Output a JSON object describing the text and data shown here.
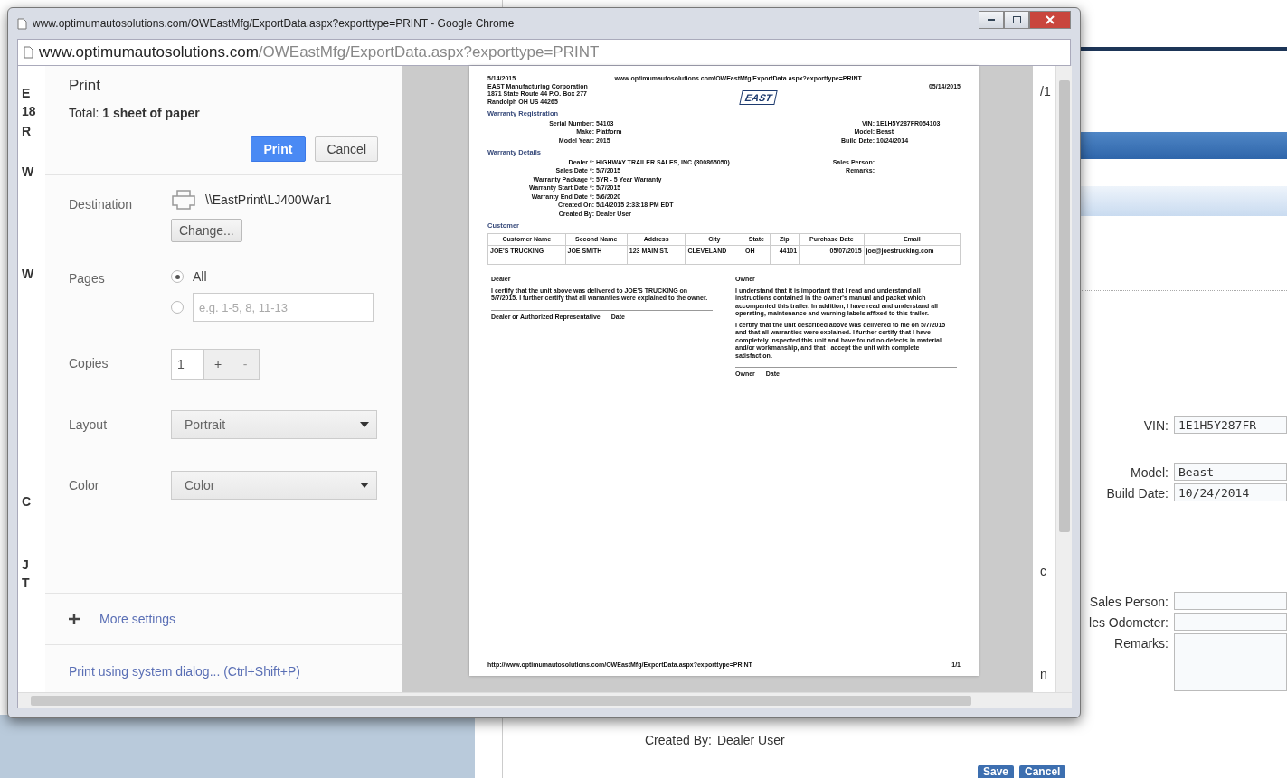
{
  "background_page": {
    "left_cut_texts": [
      "E",
      "18",
      "R",
      "W",
      "W",
      "C",
      "J",
      "T"
    ],
    "right_cut_texts": [
      "/1",
      "c",
      "n"
    ],
    "form_fields": [
      {
        "label": "VIN:",
        "kind": "input",
        "value": "1E1H5Y287FR"
      },
      {
        "label": "Model:",
        "kind": "input",
        "value": "Beast"
      },
      {
        "label": "Build Date:",
        "kind": "input",
        "value": "10/24/2014"
      },
      {
        "label": "Sales Person:",
        "kind": "input"
      },
      {
        "label": "les Odometer:",
        "kind": "input"
      },
      {
        "label": "Remarks:",
        "kind": "textarea"
      }
    ],
    "created_by": {
      "label": "Created By:",
      "value": "Dealer User"
    },
    "buttons": [
      "Save",
      "Cancel"
    ]
  },
  "browser_window": {
    "title": "www.optimumautosolutions.com/OWEastMfg/ExportData.aspx?exporttype=PRINT - Google Chrome",
    "address": {
      "host": "www.optimumautosolutions.com",
      "path": "/OWEastMfg/ExportData.aspx?exporttype=PRINT"
    }
  },
  "print_panel": {
    "title": "Print",
    "total": "Total: **1 sheet of paper**",
    "buttons": [
      {
        "label": "Print",
        "kind": "primary"
      },
      {
        "label": "Cancel",
        "kind": "secondary"
      }
    ],
    "destination": {
      "label": "Destination",
      "printer": "\\\\EastPrint\\LJ400War1",
      "change": "Change..."
    },
    "pages": {
      "label": "Pages",
      "options": [
        {
          "label": "All",
          "selected": true
        },
        {
          "placeholder": "e.g. 1-5, 8, 11-13",
          "selected": false
        }
      ]
    },
    "copies": {
      "label": "Copies",
      "value": "1",
      "plus": "+",
      "minus": "-"
    },
    "layout": {
      "label": "Layout",
      "value": "Portrait"
    },
    "color": {
      "label": "Color",
      "value": "Color"
    },
    "more_settings": "More settings",
    "system_dialog": "Print using system dialog... (Ctrl+Shift+P)"
  },
  "preview_page": {
    "date": "5/14/2015",
    "url": "www.optimumautosolutions.com/OWEastMfg/ExportData.aspx?exporttype=PRINT",
    "company": [
      "EAST Manufacturing Corporation",
      "1871 State Route 44 P.O. Box 277",
      "Randolph OH US 44265"
    ],
    "logo": "EAST",
    "doc_date": "05/14/2015",
    "sections": [
      {
        "title": "Warranty Registration",
        "left": [
          {
            "label": "Serial Number:",
            "value": "54103"
          },
          {
            "label": "Make:",
            "value": "Platform"
          },
          {
            "label": "Model Year:",
            "value": "2015"
          }
        ],
        "right": [
          {
            "label": "VIN:",
            "value": "1E1H5Y287FR054103"
          },
          {
            "label": "Model:",
            "value": "Beast"
          },
          {
            "label": "Build Date:",
            "value": "10/24/2014"
          }
        ]
      },
      {
        "title": "Warranty Details",
        "left": [
          {
            "label": "Dealer *:",
            "value": "HIGHWAY TRAILER SALES, INC (300865050)"
          },
          {
            "label": "Sales Date *:",
            "value": "5/7/2015"
          },
          {
            "label": "Warranty Package *:",
            "value": "5YR - 5 Year Warranty"
          },
          {
            "label": "Warranty Start Date *:",
            "value": "5/7/2015"
          },
          {
            "label": "Warranty End Date *:",
            "value": "5/6/2020"
          },
          {
            "label": "Created On:",
            "value": "5/14/2015 2:33:18 PM EDT"
          },
          {
            "label": "Created By:",
            "value": "Dealer User"
          }
        ],
        "right": [
          {
            "label": "Sales Person:"
          },
          {
            "label": "Remarks:"
          }
        ]
      }
    ],
    "customer": {
      "title": "Customer",
      "columns": [
        "Customer Name",
        "Second Name",
        "Address",
        "City",
        "State",
        "Zip",
        "Purchase Date",
        "Email"
      ],
      "rows": [
        [
          "JOE'S TRUCKING",
          "JOE SMITH",
          "123 MAIN ST.",
          "CLEVELAND",
          "OH",
          "44101",
          "05/07/2015",
          "joe@joestrucking.com"
        ]
      ]
    },
    "dealer": {
      "title": "Dealer",
      "paragraphs": [
        "I certify that the unit above was delivered to JOE'S TRUCKING on 5/7/2015. I further certify that all warranties were explained to the owner."
      ],
      "signature": [
        "Dealer or Authorized Representative",
        "Date"
      ]
    },
    "owner": {
      "title": "Owner",
      "paragraphs": [
        "I understand that it is important that I read and understand all instructions contained in the owner's manual and packet which accompanied this trailer. In addition, I have read and understand all operating, maintenance and warning labels affixed to this trailer.",
        "I certify that the unit described above was delivered to me on 5/7/2015 and that all warranties were explained. I further certify that I have completely inspected this unit and have found no defects in material and/or workmanship, and that I accept the unit with complete satisfaction."
      ],
      "signature": [
        "Owner",
        "Date"
      ]
    },
    "footer_url": "http://www.optimumautosolutions.com/OWEastMfg/ExportData.aspx?exporttype=PRINT",
    "page_number": "1/1"
  }
}
